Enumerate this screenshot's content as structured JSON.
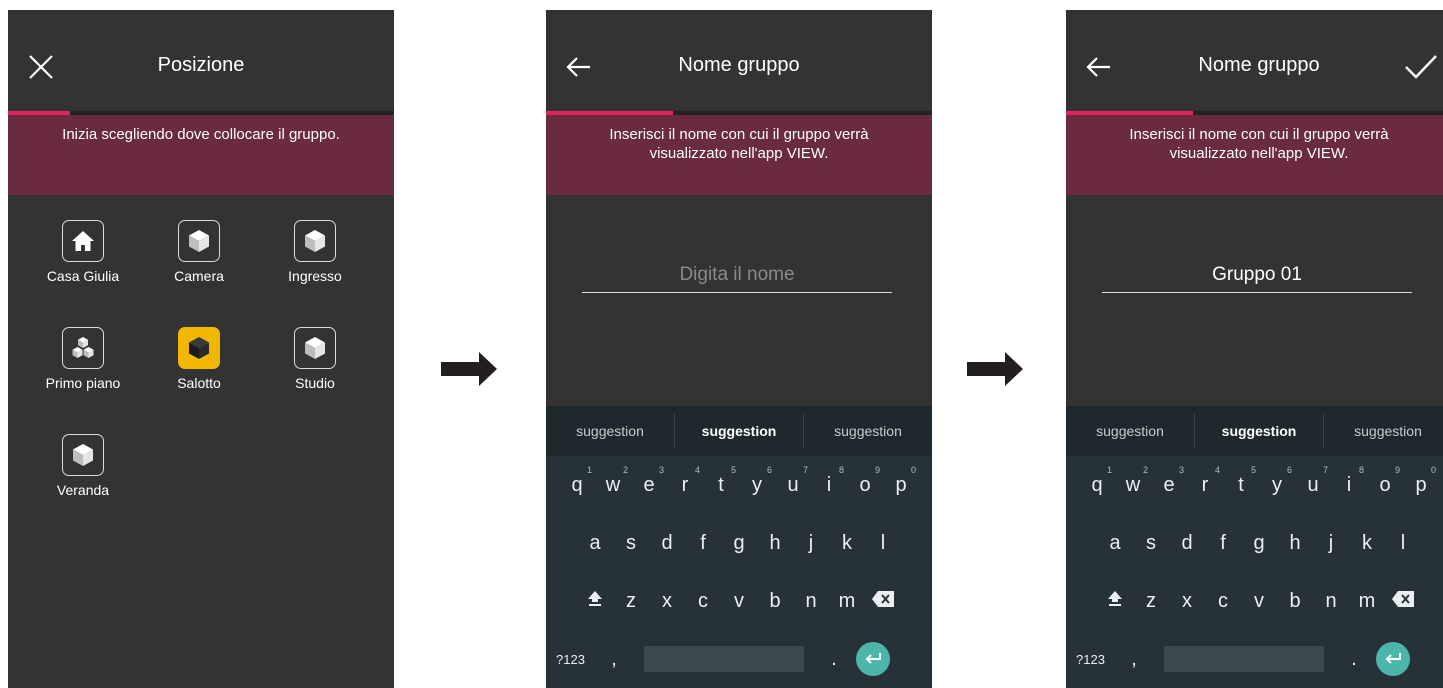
{
  "screen1": {
    "title": "Posizione",
    "close_icon": "close-icon",
    "banner": "Inizia scegliendo dove collocare il gruppo.",
    "locations": [
      {
        "label": "Casa Giulia",
        "icon": "house-icon",
        "selected": false
      },
      {
        "label": "Camera",
        "icon": "cube-icon",
        "selected": false
      },
      {
        "label": "Ingresso",
        "icon": "cube-icon",
        "selected": false
      },
      {
        "label": "Primo piano",
        "icon": "cubes-icon",
        "selected": false
      },
      {
        "label": "Salotto",
        "icon": "cube-icon",
        "selected": true
      },
      {
        "label": "Studio",
        "icon": "cube-icon",
        "selected": false
      },
      {
        "label": "Veranda",
        "icon": "cube-icon",
        "selected": false
      }
    ],
    "progress": 0.16
  },
  "screen2": {
    "title": "Nome gruppo",
    "back_icon": "arrow-left-icon",
    "banner": "Inserisci il nome con cui il gruppo verrà visualizzato nell'app VIEW.",
    "input_placeholder": "Digita il nome",
    "input_value": "",
    "progress": 0.33
  },
  "screen3": {
    "title": "Nome gruppo",
    "back_icon": "arrow-left-icon",
    "confirm_icon": "checkmark-icon",
    "banner": "Inserisci il nome con cui il gruppo verrà visualizzato nell'app VIEW.",
    "input_value": "Gruppo 01",
    "progress": 0.33
  },
  "keyboard": {
    "suggestions": [
      "suggestion",
      "suggestion",
      "suggestion"
    ],
    "row1": [
      {
        "k": "q",
        "n": "1"
      },
      {
        "k": "w",
        "n": "2"
      },
      {
        "k": "e",
        "n": "3"
      },
      {
        "k": "r",
        "n": "4"
      },
      {
        "k": "t",
        "n": "5"
      },
      {
        "k": "y",
        "n": "6"
      },
      {
        "k": "u",
        "n": "7"
      },
      {
        "k": "i",
        "n": "8"
      },
      {
        "k": "o",
        "n": "9"
      },
      {
        "k": "p",
        "n": "0"
      }
    ],
    "row2": [
      "a",
      "s",
      "d",
      "f",
      "g",
      "h",
      "j",
      "k",
      "l"
    ],
    "row3": [
      "z",
      "x",
      "c",
      "v",
      "b",
      "n",
      "m"
    ],
    "numbers_key": "?123",
    "comma_key": ",",
    "period_key": "."
  },
  "colors": {
    "background": "#333333",
    "banner": "#6a2b3e",
    "progress": "#e0245e",
    "selected_tile": "#f2b705",
    "keyboard": "#263238",
    "enter_key": "#4db6ac"
  },
  "arrow_icon": "arrow-right-icon"
}
